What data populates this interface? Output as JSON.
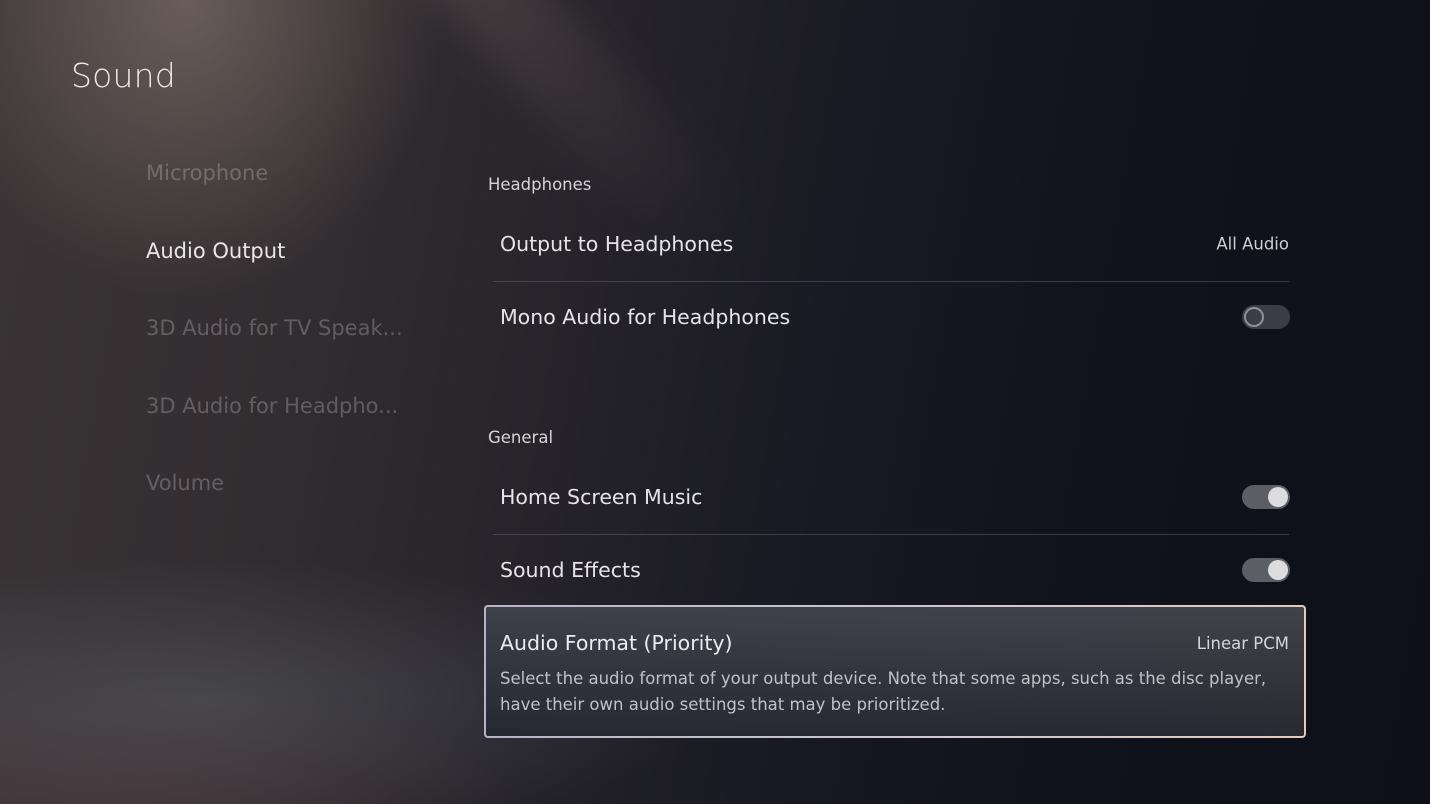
{
  "page": {
    "title": "Sound"
  },
  "sidebar": {
    "items": [
      {
        "label": "Microphone",
        "active": false
      },
      {
        "label": "Audio Output",
        "active": true
      },
      {
        "label": "3D Audio for TV Speak...",
        "active": false
      },
      {
        "label": "3D Audio for Headpho...",
        "active": false
      },
      {
        "label": "Volume",
        "active": false
      }
    ]
  },
  "sections": {
    "headphones": {
      "header": "Headphones",
      "rows": [
        {
          "label": "Output to Headphones",
          "value": "All Audio"
        },
        {
          "label": "Mono Audio for Headphones",
          "toggle": "off"
        }
      ]
    },
    "general": {
      "header": "General",
      "rows": [
        {
          "label": "Home Screen Music",
          "toggle": "on"
        },
        {
          "label": "Sound Effects",
          "toggle": "on"
        }
      ],
      "focused": {
        "label": "Audio Format (Priority)",
        "value": "Linear PCM",
        "description": "Select the audio format of your output device. Note that some apps, such as the disc player, have their own audio settings that may be prioritized."
      }
    }
  },
  "colors": {
    "focus_border_start": "#b5b4c6",
    "focus_border_end": "#e3cbb8",
    "toggle_on_knob": "#dcdcde",
    "toggle_off_track": "#3a3c48"
  }
}
